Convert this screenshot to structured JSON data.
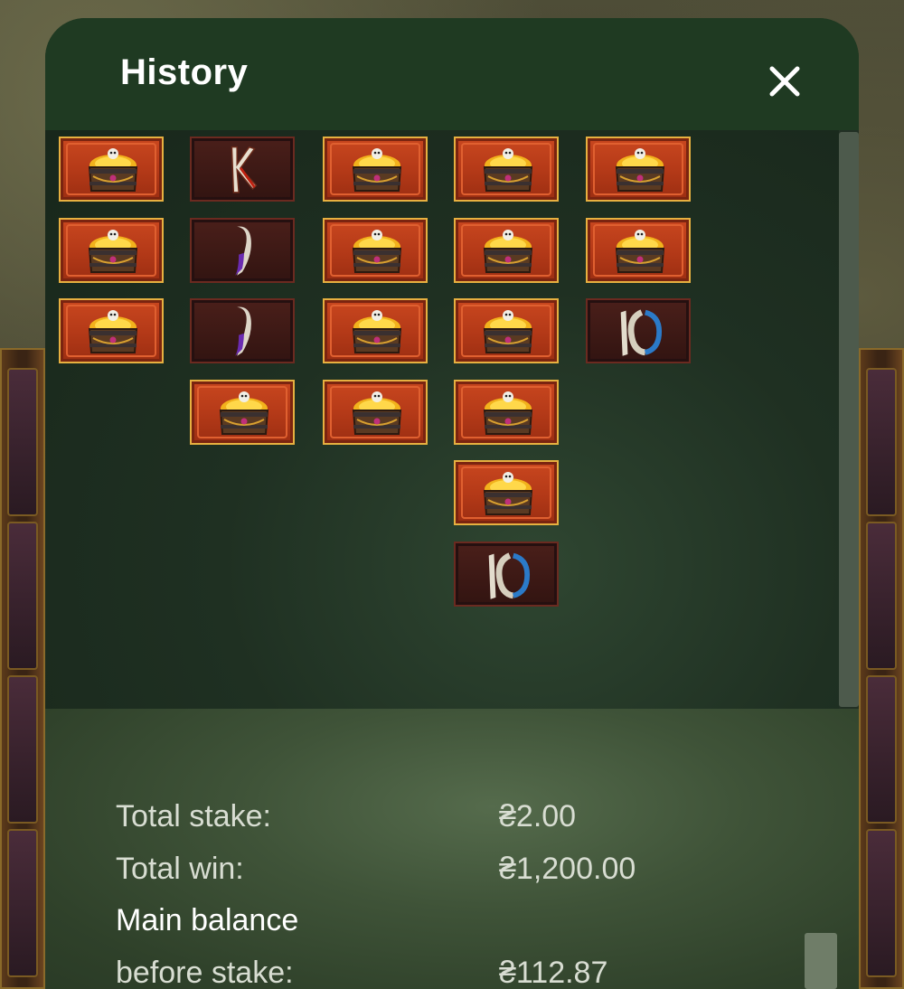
{
  "dialog": {
    "title": "History",
    "close_label": "close"
  },
  "reels": {
    "columns": [
      [
        "chest",
        "chest",
        "chest"
      ],
      [
        "K",
        "J",
        "J",
        "chest"
      ],
      [
        "chest",
        "chest",
        "chest",
        "chest"
      ],
      [
        "chest",
        "chest",
        "chest",
        "chest",
        "chest",
        "10"
      ],
      [
        "chest",
        "chest",
        "10"
      ]
    ]
  },
  "summary": {
    "total_stake_label": "Total stake:",
    "total_stake_value": "₴2.00",
    "total_win_label": "Total win:",
    "total_win_value": "₴1,200.00",
    "main_balance_label": "Main balance",
    "before_stake_label": "before stake:",
    "before_stake_value": "₴112.87"
  },
  "colors": {
    "header": "#1f3a22",
    "chest_tile": "#c9471f",
    "card_tile": "#4a1f1a",
    "gold_border": "#e7b040"
  }
}
